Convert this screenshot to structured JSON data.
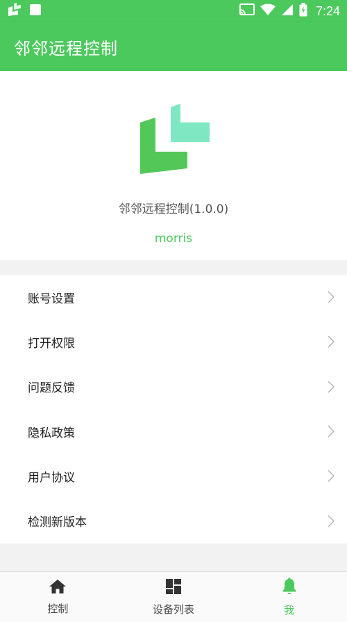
{
  "status_bar": {
    "time": "7:24",
    "icons": [
      "app-logo-icon",
      "square-icon",
      "cast-icon",
      "wifi-icon",
      "signal-icon",
      "battery-icon"
    ]
  },
  "app_bar": {
    "title": "邻邻远程控制"
  },
  "profile": {
    "app_version": "邻邻远程控制(1.0.0)",
    "username": "morris"
  },
  "menu": {
    "items": [
      {
        "label": "账号设置"
      },
      {
        "label": "打开权限"
      },
      {
        "label": "问题反馈"
      },
      {
        "label": "隐私政策"
      },
      {
        "label": "用户协议"
      },
      {
        "label": "检测新版本"
      }
    ]
  },
  "bottom_nav": {
    "items": [
      {
        "label": "控制",
        "icon": "home-icon"
      },
      {
        "label": "设备列表",
        "icon": "dashboard-icon"
      },
      {
        "label": "我",
        "icon": "bell-icon",
        "active": true
      }
    ]
  },
  "colors": {
    "brand": "#4cc95d",
    "logo_light": "#7ee8c2",
    "background": "#f2f2f2"
  }
}
